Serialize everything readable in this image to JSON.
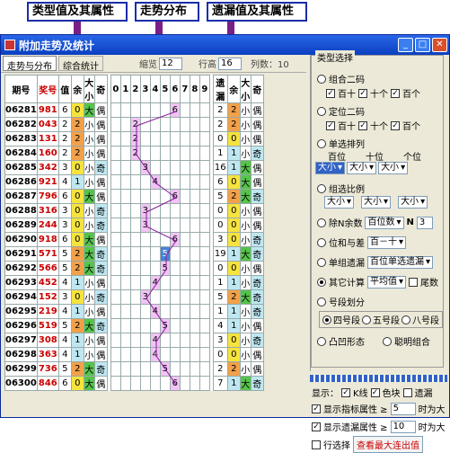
{
  "callouts": [
    "类型值及其属性",
    "走势分布",
    "遗漏值及其属性"
  ],
  "window": {
    "title": "附加走势及统计"
  },
  "toolbar": {
    "tab1": "走势与分布",
    "tab2": "综合统计",
    "zoom_label": "缩览",
    "zoom_value": "12",
    "rows_label": "行高",
    "rows_value": "16",
    "cols_text": "列数：10"
  },
  "table": {
    "headers": {
      "period": "期号",
      "prize": "奖号",
      "val": "值",
      "rem": "余",
      "size": "大小",
      "odd": "奇",
      "miss": "遗漏",
      "miss_rem": "余",
      "miss_size": "大小",
      "miss_odd": "奇"
    },
    "trend_digits": [
      "0",
      "1",
      "2",
      "3",
      "4",
      "5",
      "6",
      "7",
      "8",
      "9"
    ],
    "rows": [
      {
        "id": "06281",
        "num": "981",
        "v": "6",
        "r": "0",
        "s": "大",
        "o": "偶",
        "t": 6,
        "m": "2",
        "mr": "2",
        "ms": "小",
        "mo": "偶"
      },
      {
        "id": "06282",
        "num": "043",
        "v": "2",
        "r": "2",
        "s": "小",
        "o": "偶",
        "t": 2,
        "m": "2",
        "mr": "2",
        "ms": "小",
        "mo": "偶"
      },
      {
        "id": "06283",
        "num": "131",
        "v": "2",
        "r": "2",
        "s": "小",
        "o": "偶",
        "t": 2,
        "m": "0",
        "mr": "0",
        "ms": "小",
        "mo": "偶"
      },
      {
        "id": "06284",
        "num": "160",
        "v": "2",
        "r": "2",
        "s": "小",
        "o": "偶",
        "t": 2,
        "m": "1",
        "mr": "1",
        "ms": "小",
        "mo": "奇"
      },
      {
        "id": "06285",
        "num": "342",
        "v": "3",
        "r": "0",
        "s": "小",
        "o": "奇",
        "t": 3,
        "m": "16",
        "mr": "1",
        "ms": "大",
        "mo": "偶"
      },
      {
        "id": "06286",
        "num": "921",
        "v": "4",
        "r": "1",
        "s": "小",
        "o": "偶",
        "t": 4,
        "m": "6",
        "mr": "0",
        "ms": "大",
        "mo": "偶"
      },
      {
        "id": "06287",
        "num": "796",
        "v": "6",
        "r": "0",
        "s": "大",
        "o": "偶",
        "t": 6,
        "m": "5",
        "mr": "2",
        "ms": "大",
        "mo": "奇"
      },
      {
        "id": "06288",
        "num": "316",
        "v": "3",
        "r": "0",
        "s": "小",
        "o": "奇",
        "t": 3,
        "m": "0",
        "mr": "0",
        "ms": "小",
        "mo": "偶"
      },
      {
        "id": "06289",
        "num": "244",
        "v": "3",
        "r": "0",
        "s": "小",
        "o": "奇",
        "t": 3,
        "m": "0",
        "mr": "0",
        "ms": "小",
        "mo": "偶"
      },
      {
        "id": "06290",
        "num": "918",
        "v": "6",
        "r": "0",
        "s": "大",
        "o": "偶",
        "t": 6,
        "m": "3",
        "mr": "0",
        "ms": "小",
        "mo": "奇"
      },
      {
        "id": "06291",
        "num": "571",
        "v": "5",
        "r": "2",
        "s": "大",
        "o": "奇",
        "t": 5,
        "m": "19",
        "mr": "1",
        "ms": "大",
        "mo": "奇"
      },
      {
        "id": "06292",
        "num": "566",
        "v": "5",
        "r": "2",
        "s": "大",
        "o": "奇",
        "t": 5,
        "m": "0",
        "mr": "0",
        "ms": "小",
        "mo": "偶"
      },
      {
        "id": "06293",
        "num": "452",
        "v": "4",
        "r": "1",
        "s": "小",
        "o": "偶",
        "t": 4,
        "m": "1",
        "mr": "1",
        "ms": "小",
        "mo": "奇"
      },
      {
        "id": "06294",
        "num": "152",
        "v": "3",
        "r": "0",
        "s": "小",
        "o": "奇",
        "t": 3,
        "m": "5",
        "mr": "2",
        "ms": "大",
        "mo": "奇"
      },
      {
        "id": "06295",
        "num": "219",
        "v": "4",
        "r": "1",
        "s": "小",
        "o": "偶",
        "t": 4,
        "m": "1",
        "mr": "1",
        "ms": "小",
        "mo": "奇"
      },
      {
        "id": "06296",
        "num": "519",
        "v": "5",
        "r": "2",
        "s": "大",
        "o": "奇",
        "t": 5,
        "m": "4",
        "mr": "1",
        "ms": "小",
        "mo": "偶"
      },
      {
        "id": "06297",
        "num": "308",
        "v": "4",
        "r": "1",
        "s": "小",
        "o": "偶",
        "t": 4,
        "m": "3",
        "mr": "0",
        "ms": "小",
        "mo": "奇"
      },
      {
        "id": "06298",
        "num": "363",
        "v": "4",
        "r": "1",
        "s": "小",
        "o": "偶",
        "t": 4,
        "m": "0",
        "mr": "0",
        "ms": "小",
        "mo": "偶"
      },
      {
        "id": "06299",
        "num": "736",
        "v": "5",
        "r": "2",
        "s": "大",
        "o": "奇",
        "t": 5,
        "m": "2",
        "mr": "2",
        "ms": "小",
        "mo": "偶"
      },
      {
        "id": "06300",
        "num": "846",
        "v": "6",
        "r": "0",
        "s": "大",
        "o": "偶",
        "t": 6,
        "m": "7",
        "mr": "1",
        "ms": "大",
        "mo": "奇"
      }
    ]
  },
  "panel": {
    "legend": "类型选择",
    "opt_combo2": "组合二码",
    "chk_hundreds": "百十",
    "chk_tens": "十个",
    "chk_units": "百个",
    "opt_pos2": "定位二码",
    "opt_single": "单选排列",
    "lbl_hundred": "百位",
    "lbl_ten": "十位",
    "lbl_one": "个位",
    "sel_1": "大小",
    "sel_2": "大小",
    "sel_3": "大小",
    "opt_ratio": "组选比例",
    "sel_4": "大小",
    "sel_5": "大小",
    "sel_6": "大小",
    "opt_modn": "除N余数",
    "sel_modn": "百位数",
    "n_label": "N",
    "n_value": "3",
    "opt_sumdiff": "位和与差",
    "sel_sumdiff": "百－十",
    "opt_miss": "单组遗漏",
    "sel_miss": "百位单选遗漏",
    "opt_other": "其它计算",
    "sel_other": "平均值",
    "chk_tail": "尾数",
    "opt_seg": "号段划分",
    "opt_seg4": "四号段",
    "opt_seg5": "五号段",
    "opt_seg8": "八号段",
    "opt_shape": "凸凹形态",
    "opt_smart": "聪明组合"
  },
  "bottom": {
    "show_label": "显示：",
    "chk_k": "K线",
    "chk_color": "色块",
    "chk_miss": "遗漏",
    "chk_attr": "显示指标属性 ≥",
    "attr_value": "5",
    "attr_suffix": "时为大",
    "chk_missattr": "显示遗漏属性 ≥",
    "missattr_value": "10",
    "missattr_suffix": "时为大",
    "chk_row": "行选择",
    "btn_query": "查看最大连出值"
  },
  "colors": {
    "title_bar": "#0a3fbf",
    "callout_border": "#1a2ea8",
    "arrow": "#7a1f86",
    "trend_cell": "#f0c4f4",
    "accent_red": "#cc0000"
  }
}
